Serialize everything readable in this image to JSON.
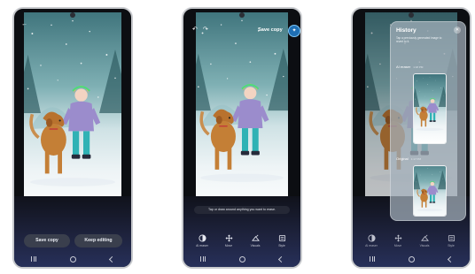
{
  "screens": {
    "a": {
      "save_copy_label": "Save copy",
      "keep_editing_label": "Keep editing"
    },
    "b": {
      "save_copy_label": "Save copy",
      "hint": "Tap or draw around anything you want to erase.",
      "tools": [
        {
          "label": "AI eraser",
          "icon": "eraser-icon"
        },
        {
          "label": "Move",
          "icon": "move-icon"
        },
        {
          "label": "Visuals",
          "icon": "visuals-icon"
        },
        {
          "label": "Style",
          "icon": "style-icon"
        }
      ]
    },
    "c": {
      "history": {
        "title": "History",
        "subtitle": "Tap a previously generated image to revert to it.",
        "items": [
          {
            "label": "AI eraser",
            "time": "1:18 PM"
          },
          {
            "label": "Original",
            "time": "1:17 PM"
          }
        ]
      },
      "tools": [
        {
          "label": "AI eraser",
          "icon": "eraser-icon"
        },
        {
          "label": "Move",
          "icon": "move-icon"
        },
        {
          "label": "Visuals",
          "icon": "visuals-icon"
        },
        {
          "label": "Style",
          "icon": "style-icon"
        }
      ]
    }
  }
}
